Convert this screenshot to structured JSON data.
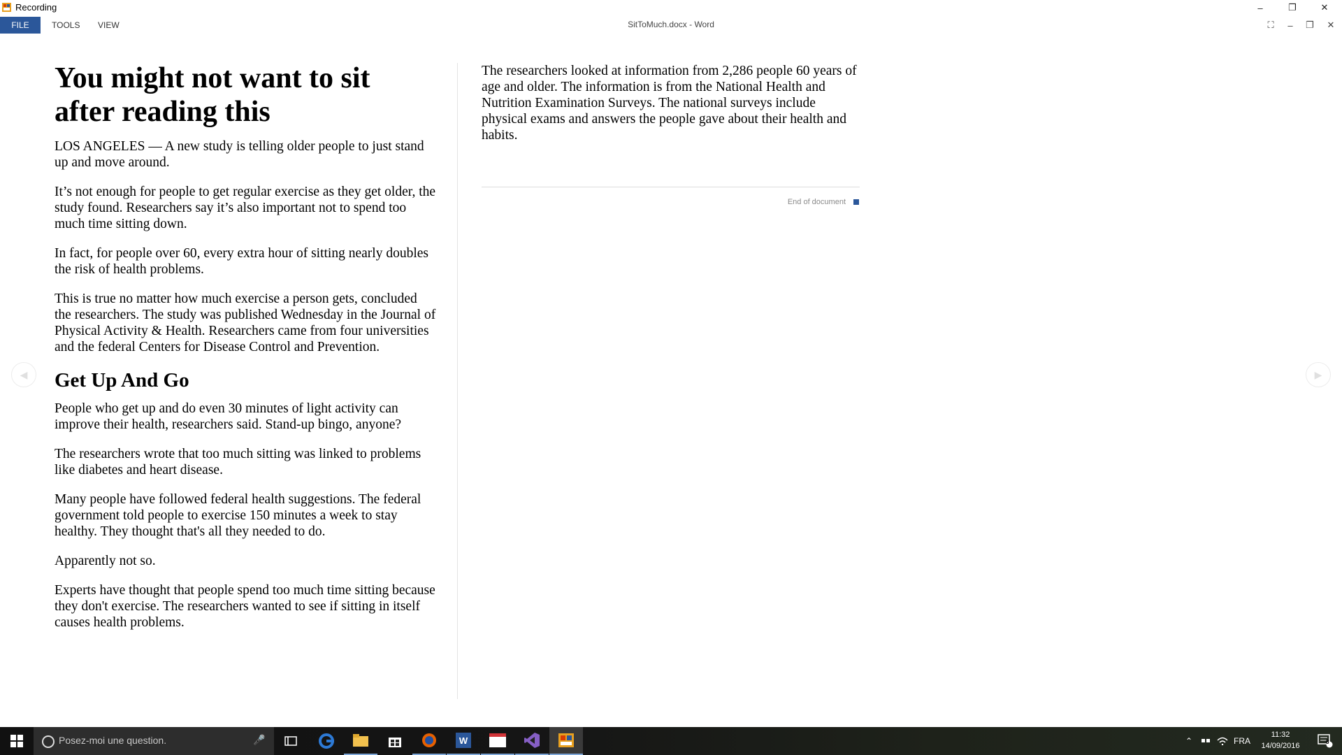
{
  "window": {
    "title": "Recording",
    "controls": {
      "minimize": "–",
      "restore": "❐",
      "close": "✕"
    }
  },
  "menu": [
    "FILE",
    "TOOLS",
    "VIEW"
  ],
  "document_title": "SitToMuch.docx - Word",
  "inner_controls": {
    "fit": "⛶",
    "minimize": "–",
    "restore": "❐",
    "close": "✕"
  },
  "article": {
    "headline": "You might not want to sit after reading this",
    "left_paragraphs": [
      "LOS ANGELES — A new study is telling older people to just stand up and move around.",
      "It’s not enough for people to get regular exercise as they get older, the study found. Researchers say it’s also important not to spend too much time sitting down.",
      "In fact, for people over 60, every extra hour of sitting nearly doubles the risk of health problems.",
      "This is true no matter how much exercise a person gets, con­cluded the researchers. The study was published Wednesday in the Journal of Physical Activity & Health. Researchers came from four universities and the federal Centers for Disease Con­trol and Prevention."
    ],
    "subhead": "Get Up And Go",
    "section_paragraphs": [
      "People who get up and do even 30 minutes of light activity can improve their health, researchers said. Stand-up bingo, anyone?",
      "The researchers wrote that too much sitting was linked to prob­lems like diabetes and heart disease.",
      "Many people have followed federal health suggestions. The federal government told people to exercise 150 minutes a week to stay healthy. They thought that's all they needed to do.",
      "Apparently not so.",
      "Experts have thought that people spend too much time sitting because they don't exercise. The researchers wanted to see if sit­ting in itself causes health problems."
    ],
    "right_paragraphs": [
      "The researchers looked at information from 2,286 people 60 years of age and older. The information is from the National Health and Nutrition Examination Surveys. The national sur­veys include physical exams and answers the people gave about their health and habits."
    ],
    "end_label": "End of document"
  },
  "navigation": {
    "prev_icon": "◀",
    "next_icon": "▶"
  },
  "taskbar": {
    "search_placeholder": "Posez-moi une question.",
    "tray": {
      "caret": "⌃",
      "language": "FRA",
      "time": "11:32",
      "date": "14/09/2016",
      "notifications": "8"
    }
  },
  "colors": {
    "accent": "#2b579a",
    "taskbar": "#111111"
  }
}
